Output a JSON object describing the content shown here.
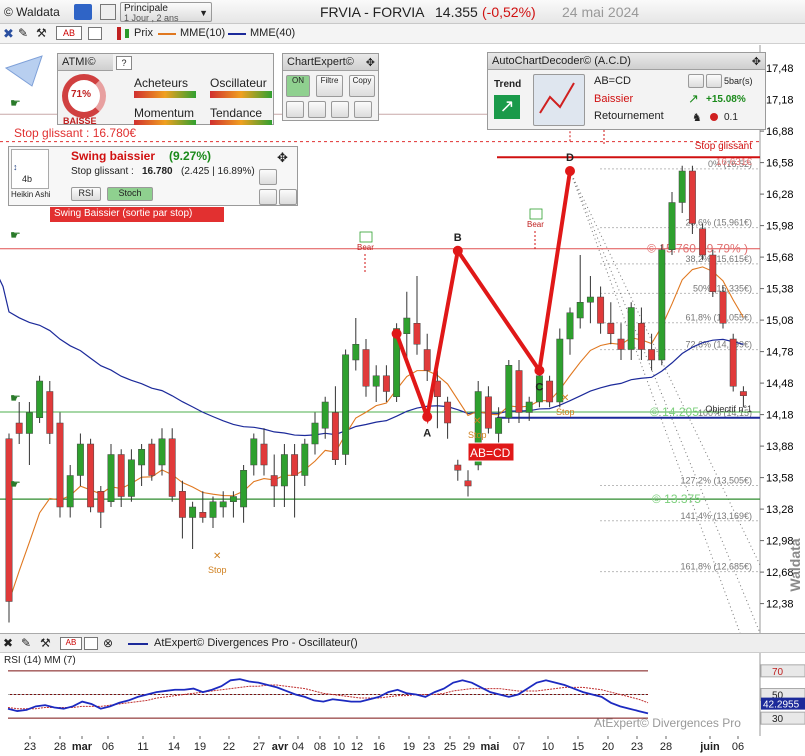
{
  "header": {
    "app": "© Waldata",
    "principale_label": "Principale",
    "period": "1 Jour , 2 ans",
    "ticker": "FRVIA - FORVIA",
    "price": "14.355",
    "change": "(-0,52%)",
    "date": "24 mai 2024"
  },
  "toolbar": {
    "prix": "Prix",
    "mme10": "MME(10)",
    "mme40": "MME(40)"
  },
  "atmi": {
    "title": "ATMI©",
    "percent": "71%",
    "state": "BAISSE",
    "labels": [
      "Acheteurs",
      "Oscillateur",
      "Momentum",
      "Tendance"
    ]
  },
  "chartexpert": {
    "title": "ChartExpert©",
    "buttons": [
      "ON",
      "Filtre",
      "Copy"
    ]
  },
  "acd": {
    "title": "AutoChartDecoder© (A.C.D)",
    "trend_label": "Trend",
    "pattern": "AB=CD",
    "direction": "Baissier",
    "type": "Retournement",
    "bars": "5bar(s)",
    "perf": "+15.08%",
    "value": "0.1"
  },
  "stop": {
    "label": "Stop glissant : 16.780€"
  },
  "swing": {
    "title": "Swing baissier",
    "pct": "(9.27%)",
    "line_label": "Stop glissant :",
    "line_value": "16.780",
    "line_detail": "(2.425 | 16.89%)",
    "rsi_btn": "RSI",
    "stoch_btn": "Stoch",
    "heikin": "Heikin Ashi",
    "badge": "4b",
    "banner": "Swing Baissier (sortie par stop)"
  },
  "annotations": {
    "stop_glissant_right": "Stop glissant",
    "stop_value_right": "16,631€",
    "resistance": "© 15.760 ( 9.79% )",
    "support1": "© 14.205",
    "objectif": "Objectif n°1",
    "support2": "© 13.375",
    "abcd_tag": "AB=CD",
    "points": [
      "A",
      "B",
      "C",
      "D"
    ],
    "bear": "Bear",
    "stop": "Stop",
    "watermark": "Waldata"
  },
  "fibo": [
    {
      "label": "0% (16,52)",
      "price": 16.52
    },
    {
      "label": "23,6% (15,961€)",
      "price": 15.961
    },
    {
      "label": "38,2% (15,615€)",
      "price": 15.615
    },
    {
      "label": "50% (15,335€)",
      "price": 15.335
    },
    {
      "label": "61,8% (15,055€)",
      "price": 15.055
    },
    {
      "label": "72,6% (14,799€)",
      "price": 14.799
    },
    {
      "label": "100% (14,15)",
      "price": 14.15
    },
    {
      "label": "127,2% (13,505€)",
      "price": 13.505
    },
    {
      "label": "141,4% (13,169€)",
      "price": 13.169
    },
    {
      "label": "161,8% (12,685€)",
      "price": 12.685
    }
  ],
  "oscillator": {
    "title": "AtExpert© Divergences Pro - Oscillateur()",
    "subtitle": "RSI (14) MM (7)",
    "watermark": "AtExpert© Divergences Pro",
    "scale": [
      "70",
      "50",
      "30"
    ],
    "current": "42.2955"
  },
  "chart_data": {
    "type": "candlestick",
    "title": "FRVIA - FORVIA",
    "ylim": [
      12.1,
      17.7
    ],
    "y_ticks": [
      17.48,
      17.18,
      16.88,
      16.58,
      16.28,
      15.98,
      15.68,
      15.38,
      15.08,
      14.78,
      14.48,
      14.18,
      13.88,
      13.58,
      13.28,
      12.98,
      12.68,
      12.38
    ],
    "x_ticks": [
      "23",
      "28",
      "mar",
      "06",
      "11",
      "14",
      "19",
      "22",
      "27",
      "avr",
      "04",
      "08",
      "10",
      "12",
      "16",
      "19",
      "23",
      "25",
      "29",
      "mai",
      "07",
      "10",
      "15",
      "20",
      "23",
      "28",
      "juin",
      "06"
    ],
    "candles": [
      {
        "o": 13.95,
        "h": 14.0,
        "l": 12.2,
        "c": 12.4
      },
      {
        "o": 14.1,
        "h": 14.3,
        "l": 13.9,
        "c": 14.0
      },
      {
        "o": 14.0,
        "h": 14.3,
        "l": 13.7,
        "c": 14.2
      },
      {
        "o": 14.15,
        "h": 14.55,
        "l": 14.1,
        "c": 14.5
      },
      {
        "o": 14.4,
        "h": 14.5,
        "l": 13.9,
        "c": 14.0
      },
      {
        "o": 14.1,
        "h": 14.2,
        "l": 13.2,
        "c": 13.3
      },
      {
        "o": 13.3,
        "h": 13.7,
        "l": 13.2,
        "c": 13.6
      },
      {
        "o": 13.6,
        "h": 14.0,
        "l": 13.5,
        "c": 13.9
      },
      {
        "o": 13.9,
        "h": 13.95,
        "l": 13.25,
        "c": 13.3
      },
      {
        "o": 13.45,
        "h": 13.5,
        "l": 13.1,
        "c": 13.25
      },
      {
        "o": 13.35,
        "h": 13.9,
        "l": 13.3,
        "c": 13.8
      },
      {
        "o": 13.8,
        "h": 13.85,
        "l": 13.3,
        "c": 13.4
      },
      {
        "o": 13.4,
        "h": 13.85,
        "l": 13.35,
        "c": 13.75
      },
      {
        "o": 13.7,
        "h": 13.9,
        "l": 13.5,
        "c": 13.85
      },
      {
        "o": 13.9,
        "h": 13.95,
        "l": 13.55,
        "c": 13.6
      },
      {
        "o": 13.7,
        "h": 14.05,
        "l": 13.6,
        "c": 13.95
      },
      {
        "o": 13.95,
        "h": 14.05,
        "l": 13.35,
        "c": 13.4
      },
      {
        "o": 13.45,
        "h": 13.55,
        "l": 13.0,
        "c": 13.2
      },
      {
        "o": 13.2,
        "h": 13.35,
        "l": 12.9,
        "c": 13.3
      },
      {
        "o": 13.25,
        "h": 13.45,
        "l": 13.15,
        "c": 13.2
      },
      {
        "o": 13.2,
        "h": 13.4,
        "l": 13.1,
        "c": 13.35
      },
      {
        "o": 13.3,
        "h": 13.45,
        "l": 13.2,
        "c": 13.35
      },
      {
        "o": 13.35,
        "h": 13.45,
        "l": 13.2,
        "c": 13.4
      },
      {
        "o": 13.3,
        "h": 13.7,
        "l": 13.15,
        "c": 13.65
      },
      {
        "o": 13.7,
        "h": 14.0,
        "l": 13.6,
        "c": 13.95
      },
      {
        "o": 13.9,
        "h": 14.05,
        "l": 13.6,
        "c": 13.7
      },
      {
        "o": 13.6,
        "h": 13.8,
        "l": 13.3,
        "c": 13.5
      },
      {
        "o": 13.5,
        "h": 13.9,
        "l": 13.3,
        "c": 13.8
      },
      {
        "o": 13.8,
        "h": 13.9,
        "l": 13.2,
        "c": 13.6
      },
      {
        "o": 13.6,
        "h": 13.95,
        "l": 13.5,
        "c": 13.9
      },
      {
        "o": 13.9,
        "h": 14.2,
        "l": 13.8,
        "c": 14.1
      },
      {
        "o": 14.05,
        "h": 14.35,
        "l": 13.95,
        "c": 14.3
      },
      {
        "o": 14.2,
        "h": 14.45,
        "l": 13.7,
        "c": 13.75
      },
      {
        "o": 13.8,
        "h": 14.8,
        "l": 13.7,
        "c": 14.75
      },
      {
        "o": 14.7,
        "h": 15.1,
        "l": 14.6,
        "c": 14.85
      },
      {
        "o": 14.8,
        "h": 14.9,
        "l": 14.35,
        "c": 14.45
      },
      {
        "o": 14.45,
        "h": 14.65,
        "l": 14.3,
        "c": 14.55
      },
      {
        "o": 14.55,
        "h": 14.65,
        "l": 14.3,
        "c": 14.4
      },
      {
        "o": 14.35,
        "h": 15.05,
        "l": 14.3,
        "c": 15.0
      },
      {
        "o": 14.95,
        "h": 15.35,
        "l": 14.7,
        "c": 15.1
      },
      {
        "o": 15.05,
        "h": 15.5,
        "l": 14.75,
        "c": 14.85
      },
      {
        "o": 14.8,
        "h": 14.95,
        "l": 14.5,
        "c": 14.6
      },
      {
        "o": 14.5,
        "h": 14.6,
        "l": 14.05,
        "c": 14.35
      },
      {
        "o": 14.3,
        "h": 14.35,
        "l": 13.95,
        "c": 14.1
      },
      {
        "o": 13.7,
        "h": 13.75,
        "l": 13.55,
        "c": 13.65
      },
      {
        "o": 13.55,
        "h": 13.65,
        "l": 13.4,
        "c": 13.5
      },
      {
        "o": 13.7,
        "h": 14.5,
        "l": 13.65,
        "c": 14.4
      },
      {
        "o": 14.35,
        "h": 14.45,
        "l": 14.0,
        "c": 14.05
      },
      {
        "o": 14.0,
        "h": 14.25,
        "l": 13.9,
        "c": 14.15
      },
      {
        "o": 14.15,
        "h": 14.7,
        "l": 14.1,
        "c": 14.65
      },
      {
        "o": 14.6,
        "h": 14.7,
        "l": 14.1,
        "c": 14.2
      },
      {
        "o": 14.2,
        "h": 14.35,
        "l": 14.12,
        "c": 14.3
      },
      {
        "o": 14.3,
        "h": 14.6,
        "l": 14.25,
        "c": 14.55
      },
      {
        "o": 14.5,
        "h": 14.55,
        "l": 14.25,
        "c": 14.3
      },
      {
        "o": 14.3,
        "h": 15.0,
        "l": 14.25,
        "c": 14.9
      },
      {
        "o": 14.9,
        "h": 15.2,
        "l": 14.75,
        "c": 15.15
      },
      {
        "o": 15.1,
        "h": 15.7,
        "l": 15.0,
        "c": 15.25
      },
      {
        "o": 15.25,
        "h": 15.5,
        "l": 15.05,
        "c": 15.3
      },
      {
        "o": 15.3,
        "h": 15.4,
        "l": 14.95,
        "c": 15.05
      },
      {
        "o": 15.05,
        "h": 15.25,
        "l": 14.85,
        "c": 14.95
      },
      {
        "o": 14.9,
        "h": 15.05,
        "l": 14.7,
        "c": 14.8
      },
      {
        "o": 14.8,
        "h": 15.25,
        "l": 14.7,
        "c": 15.2
      },
      {
        "o": 15.05,
        "h": 15.2,
        "l": 14.7,
        "c": 14.8
      },
      {
        "o": 14.8,
        "h": 14.95,
        "l": 14.6,
        "c": 14.7
      },
      {
        "o": 14.7,
        "h": 15.8,
        "l": 14.65,
        "c": 15.75
      },
      {
        "o": 15.75,
        "h": 16.3,
        "l": 15.7,
        "c": 16.2
      },
      {
        "o": 16.2,
        "h": 16.55,
        "l": 16.1,
        "c": 16.5
      },
      {
        "o": 16.5,
        "h": 16.55,
        "l": 15.9,
        "c": 16.0
      },
      {
        "o": 15.95,
        "h": 16.0,
        "l": 15.65,
        "c": 15.7
      },
      {
        "o": 15.7,
        "h": 15.75,
        "l": 15.3,
        "c": 15.35
      },
      {
        "o": 15.35,
        "h": 15.4,
        "l": 15.0,
        "c": 15.05
      },
      {
        "o": 14.9,
        "h": 14.95,
        "l": 14.4,
        "c": 14.45
      },
      {
        "o": 14.4,
        "h": 14.45,
        "l": 14.25,
        "c": 14.36
      }
    ],
    "series": [
      {
        "name": "MME(10)",
        "color": "#e07820"
      },
      {
        "name": "MME(40)",
        "color": "#1c2a9a"
      }
    ],
    "levels": {
      "stop": 16.78,
      "resistance": 15.76,
      "support1": 14.205,
      "support2": 13.375,
      "objective": 14.15,
      "stop_right": 16.631
    },
    "abcd": {
      "points": [
        {
          "name": "A",
          "i": 41,
          "y": 14.16
        },
        {
          "name": "B",
          "i": 44,
          "y": 15.74
        },
        {
          "name": "C",
          "i": 52,
          "y": 14.6
        },
        {
          "name": "D",
          "i": 55,
          "y": 16.5
        }
      ],
      "start": {
        "i": 38,
        "y": 14.95
      }
    },
    "oscillator": {
      "name": "RSI (14) MM (7)",
      "ylim": [
        20,
        80
      ],
      "rsi": [
        38,
        36,
        37,
        40,
        41,
        39,
        38,
        40,
        44,
        42,
        38,
        40,
        43,
        45,
        48,
        50,
        52,
        53,
        54,
        54,
        55,
        52,
        54,
        57,
        62,
        63,
        61,
        60,
        58,
        56,
        53,
        50,
        48,
        45,
        44,
        46,
        45,
        44,
        44,
        46,
        48,
        52,
        54,
        51,
        50,
        48,
        52,
        55,
        60,
        62,
        60,
        56,
        52,
        50,
        48,
        50,
        55,
        60,
        62,
        60,
        58,
        55,
        52,
        50,
        48,
        43,
        40,
        38,
        36,
        34
      ],
      "ma": [
        39,
        38,
        38,
        38,
        39,
        39,
        39,
        39,
        40,
        40,
        40,
        41,
        42,
        43,
        44,
        45,
        47,
        48,
        49,
        50,
        51,
        52,
        53,
        54,
        55,
        56,
        57,
        57,
        58,
        58,
        57,
        56,
        55,
        53,
        51,
        50,
        49,
        48,
        47,
        47,
        47,
        48,
        49,
        49,
        50,
        50,
        50,
        51,
        53,
        54,
        55,
        55,
        55,
        55,
        54,
        53,
        53,
        53,
        54,
        55,
        56,
        56,
        56,
        55,
        54,
        52,
        50,
        48,
        46,
        43
      ]
    }
  }
}
